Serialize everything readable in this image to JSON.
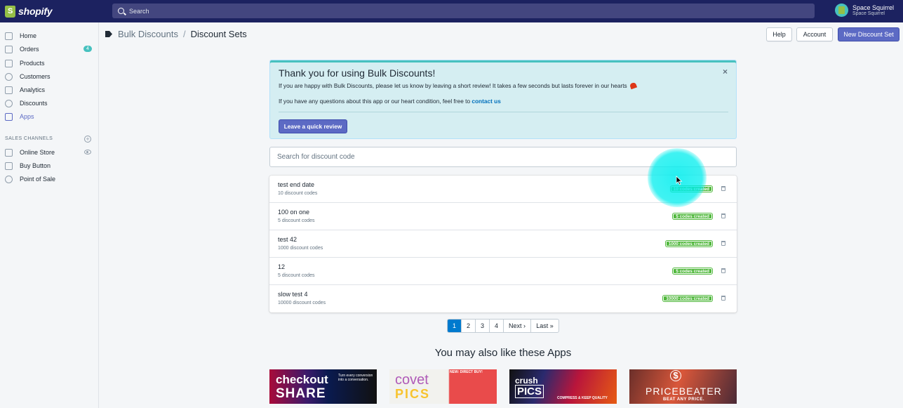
{
  "topbar": {
    "brand": "shopify",
    "search_placeholder": "Search",
    "store_name": "Space Squirrel",
    "store_sub": "Space Squirrel"
  },
  "sidebar": {
    "items": [
      {
        "label": "Home",
        "icon": "home-icon"
      },
      {
        "label": "Orders",
        "icon": "orders-icon",
        "badge": "4"
      },
      {
        "label": "Products",
        "icon": "tag-icon"
      },
      {
        "label": "Customers",
        "icon": "person-icon"
      },
      {
        "label": "Analytics",
        "icon": "bar-chart-icon"
      },
      {
        "label": "Discounts",
        "icon": "discount-icon"
      },
      {
        "label": "Apps",
        "icon": "apps-icon",
        "active": true
      }
    ],
    "section_label": "SALES CHANNELS",
    "channels": [
      {
        "label": "Online Store",
        "icon": "store-icon"
      },
      {
        "label": "Buy Button",
        "icon": "code-icon"
      },
      {
        "label": "Point of Sale",
        "icon": "location-icon"
      }
    ]
  },
  "header": {
    "breadcrumb_link": "Bulk Discounts",
    "separator": "/",
    "current": "Discount Sets",
    "help": "Help",
    "account": "Account",
    "new_set": "New Discount Set"
  },
  "banner": {
    "title": "Thank you for using Bulk Discounts!",
    "p1": "If you are happy with Bulk Discounts, please let us know by leaving a short review! It takes a few seconds but lasts forever in our hearts",
    "p2_prefix": "If you have any questions about this app or our heart condition, feel free to",
    "p2_link": "contact us",
    "button": "Leave a quick review",
    "close": "×"
  },
  "code_search": {
    "placeholder": "Search for discount code"
  },
  "discount_sets": [
    {
      "title": "test end date",
      "sub": "10 discount codes",
      "badge": "10 codes created"
    },
    {
      "title": "100 on one",
      "sub": "5 discount codes",
      "badge": "5 codes created"
    },
    {
      "title": "test 42",
      "sub": "1000 discount codes",
      "badge": "1000 codes created"
    },
    {
      "title": "12",
      "sub": "5 discount codes",
      "badge": "5 codes created"
    },
    {
      "title": "slow test 4",
      "sub": "10000 discount codes",
      "badge": "10000 codes created"
    }
  ],
  "pagination": [
    "1",
    "2",
    "3",
    "4",
    "Next ›",
    "Last »"
  ],
  "apps": {
    "title": "You may also like these Apps",
    "items": [
      {
        "line1": "checkout",
        "line2": "SHARE",
        "tag": "Turn every conversion into a conversation."
      },
      {
        "line1": "covet",
        "line2": "PICS",
        "tag": "NEW: DIRECT BUY!"
      },
      {
        "line1": "crush",
        "line2": "PICS",
        "tag": "COMPRESS & KEEP QUALITY"
      },
      {
        "line1": "PRICEBEATER",
        "line2": "$",
        "tag": "BEAT ANY PRICE."
      }
    ]
  },
  "colors": {
    "topbar": "#1c2260",
    "primary": "#5c6ac4",
    "banner_bg": "#d5eef2",
    "badge_green": "#50b83c",
    "pager_active": "#007ace"
  }
}
